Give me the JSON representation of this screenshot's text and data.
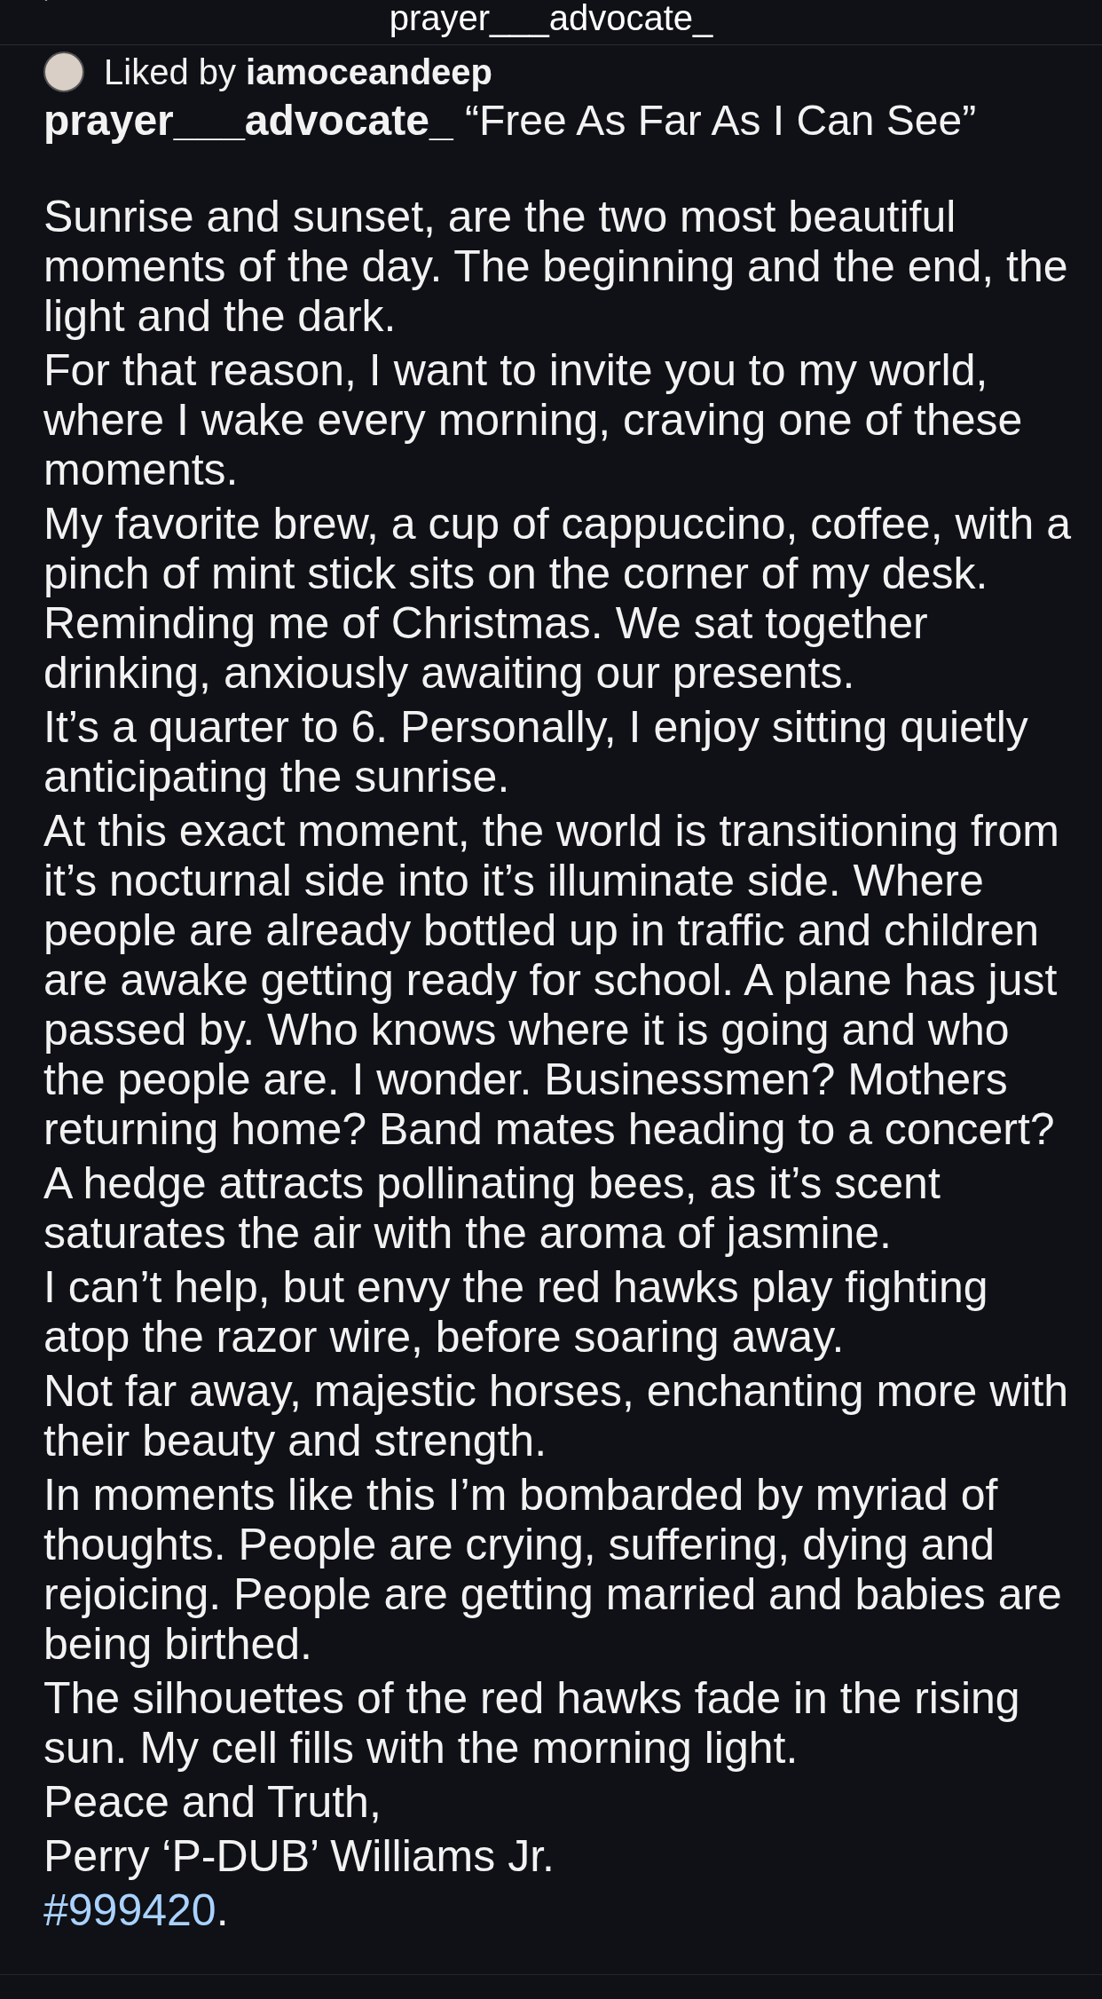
{
  "header": {
    "title": "prayer___advocate_"
  },
  "liked_by": {
    "text": "Liked by **iamoceandeep**"
  },
  "caption": {
    "author": "prayer___advocate_",
    "title": "“Free As Far As I Can See”"
  },
  "paragraphs": [
    "Sunrise and sunset, are the two most beautiful moments of the day. The beginning and the end, the light and the dark.",
    "For that reason, I want to invite you to my world, where I wake every morning, craving one of these moments.",
    "My favorite brew, a cup of cappuccino, coffee, with a pinch of mint stick sits on the corner of my desk. Reminding me of Christmas. We sat together drinking, anxiously awaiting our presents.",
    "It’s a quarter to 6. Personally, I enjoy sitting quietly anticipating the sunrise.",
    "At this exact moment, the world is transitioning from it’s nocturnal side into it’s illuminate side. Where people are already bottled up in traffic and children are awake getting ready for school. A plane has just passed by. Who knows where it is going and who the people are. I wonder. Businessmen? Mothers returning home? Band mates heading to a concert?",
    "A hedge attracts pollinating bees, as it’s scent saturates the air with the aroma of jasmine.",
    "I can’t help, but envy the red hawks play fighting atop the razor wire, before soaring away.",
    "Not far away, majestic horses, enchanting more with their beauty and strength.",
    "In moments like this I’m bombarded by myriad of thoughts. People are crying, suffering, dying and rejoicing. People are getting married and babies are being birthed.",
    "The silhouettes of the red hawks fade in the rising sun. My cell fills with the morning light.",
    "Peace and Truth,",
    "Perry ‘P-DUB’ Williams Jr."
  ],
  "hashtag": {
    "tag": "#999420",
    "trailing": "."
  }
}
